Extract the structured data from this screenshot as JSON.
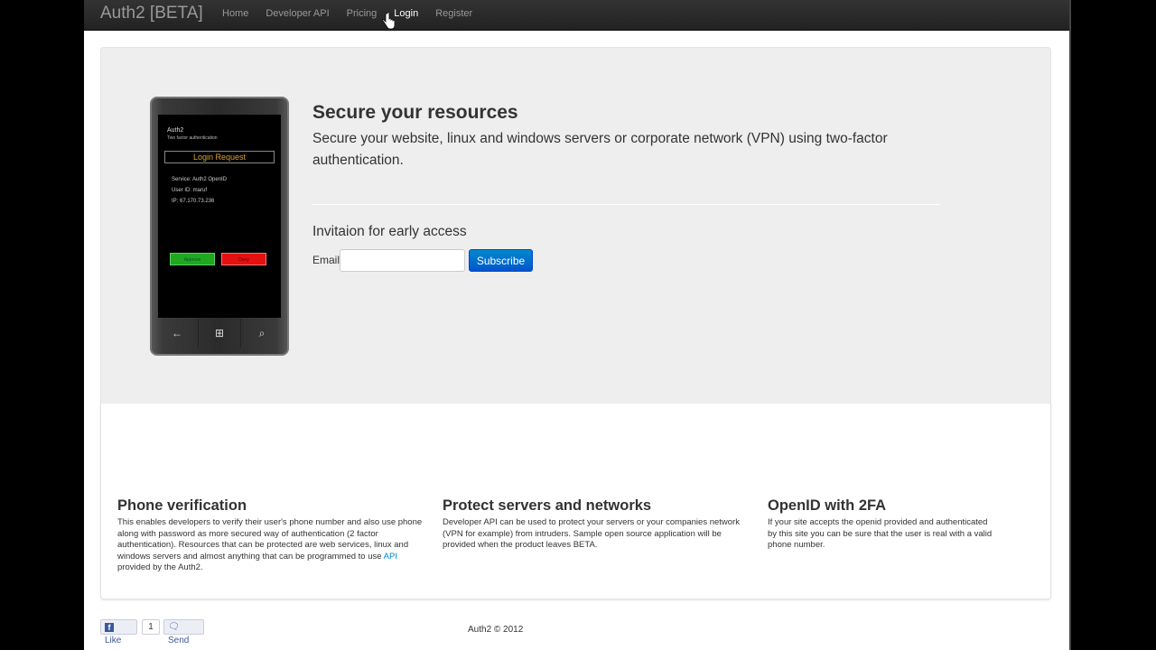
{
  "navbar": {
    "brand": "Auth2 [BETA]",
    "links": [
      "Home",
      "Developer API",
      "Pricing",
      "Login",
      "Register"
    ],
    "active_link": "Login"
  },
  "phone": {
    "app_name": "Auth2",
    "app_subtitle": "Two factor authentication",
    "request_title": "Login Request",
    "service": "Service: Auth2 OpenID",
    "user_id": "User ID: maruf",
    "ip": "IP: 67.170.73.236",
    "approve_label": "Approve",
    "deny_label": "Deny",
    "back_icon": "←",
    "windows_icon": "⊞",
    "search_icon": "⌕"
  },
  "hero": {
    "title": "Secure your resources",
    "text": "Secure your website, linux and windows servers or corporate network (VPN) using two-factor authentication.",
    "invite_heading": "Invitaion for early access",
    "email_label": "Email",
    "email_value": "",
    "subscribe_label": "Subscribe"
  },
  "features": [
    {
      "title": "Phone verification",
      "text_before": "This enables developers to verify their user's phone number and also use phone along with password as more secured way of authentication (2 factor authentication). Resources that can be protected are web services, linux and windows servers and almost anything that can be programmed to use ",
      "link": "API",
      "text_after": " provided by the Auth2."
    },
    {
      "title": "Protect servers and networks",
      "text": "Developer API can be used to protect your servers or your companies network (VPN for example) from intruders. Sample open source application will be provided when the product leaves BETA."
    },
    {
      "title": "OpenID with 2FA",
      "text": "If your site accepts the openid provided and authenticated by this site you can be sure that the user is real with a valid phone number."
    }
  ],
  "footer": {
    "like_label": "Like",
    "like_count": "1",
    "send_label": "Send",
    "copyright": "Auth2 © 2012"
  },
  "colors": {
    "navbar": "#222222",
    "hero_bg": "#eeeeee",
    "primary_button": "#0074cc",
    "link": "#0088cc"
  }
}
